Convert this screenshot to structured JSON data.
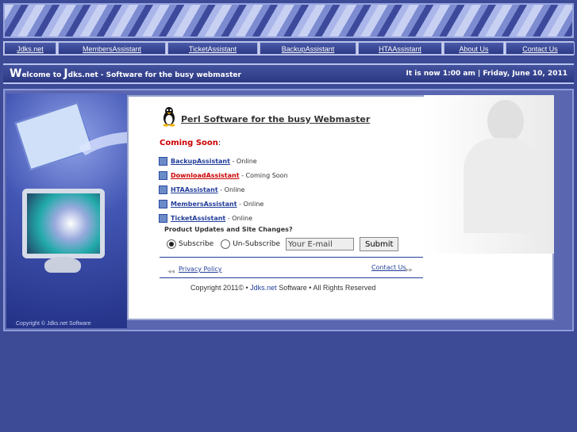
{
  "nav": [
    "Jdks.net",
    "MembersAssistant",
    "TicketAssistant",
    "BackupAssistant",
    "HTAAssistant",
    "About Us",
    "Contact Us"
  ],
  "welcome": {
    "w": "W",
    "rest": "elcome to ",
    "j": "J",
    "site": "dks.net   -   Software for the busy webmaster",
    "time": "It is now 1:00 am | Friday, June 10, 2011"
  },
  "art_copyright": "Copyright ©  Jdks.net Software",
  "title": "Perl Software for the busy Webmaster",
  "coming_soon": {
    "label": "Coming Soon",
    "colon": ":"
  },
  "items": [
    {
      "name": "BackupAssistant",
      "status": " - Online",
      "red": false
    },
    {
      "name": "DownloadAssistant",
      "status": " - Coming Soon",
      "red": true
    },
    {
      "name": "HTAAssistant",
      "status": " - Online",
      "red": false
    },
    {
      "name": "MembersAssistant",
      "status": " - Online",
      "red": false
    },
    {
      "name": "TicketAssistant",
      "status": " - Online",
      "red": false
    }
  ],
  "updates_heading": "Product Updates and Site Changes?",
  "subscribe": "Subscribe",
  "unsubscribe": "Un-Subscribe",
  "email_placeholder": "Your E-mail",
  "submit": "Submit",
  "privacy": "Privacy Policy",
  "contact": "Contact Us",
  "copyright": {
    "pre": "Copyright 2011© • ",
    "link": "Jdks.net",
    "post": " Software • All Rights Reserved"
  }
}
